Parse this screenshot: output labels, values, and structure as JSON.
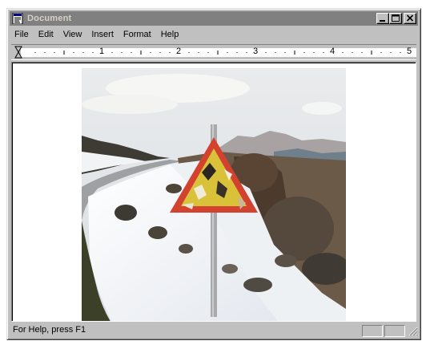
{
  "window": {
    "title": "Document",
    "icon": "document-icon",
    "controls": [
      "minimize-icon",
      "maximize-icon",
      "close-icon"
    ]
  },
  "menu": {
    "items": [
      "File",
      "Edit",
      "View",
      "Insert",
      "Format",
      "Help"
    ]
  },
  "ruler": {
    "numbers": [
      "1",
      "2",
      "3",
      "4",
      "5"
    ]
  },
  "document": {
    "content": "photo of a worn triangular warning road sign beside a snowy mountain road"
  },
  "status": {
    "text": "For Help, press F1"
  }
}
